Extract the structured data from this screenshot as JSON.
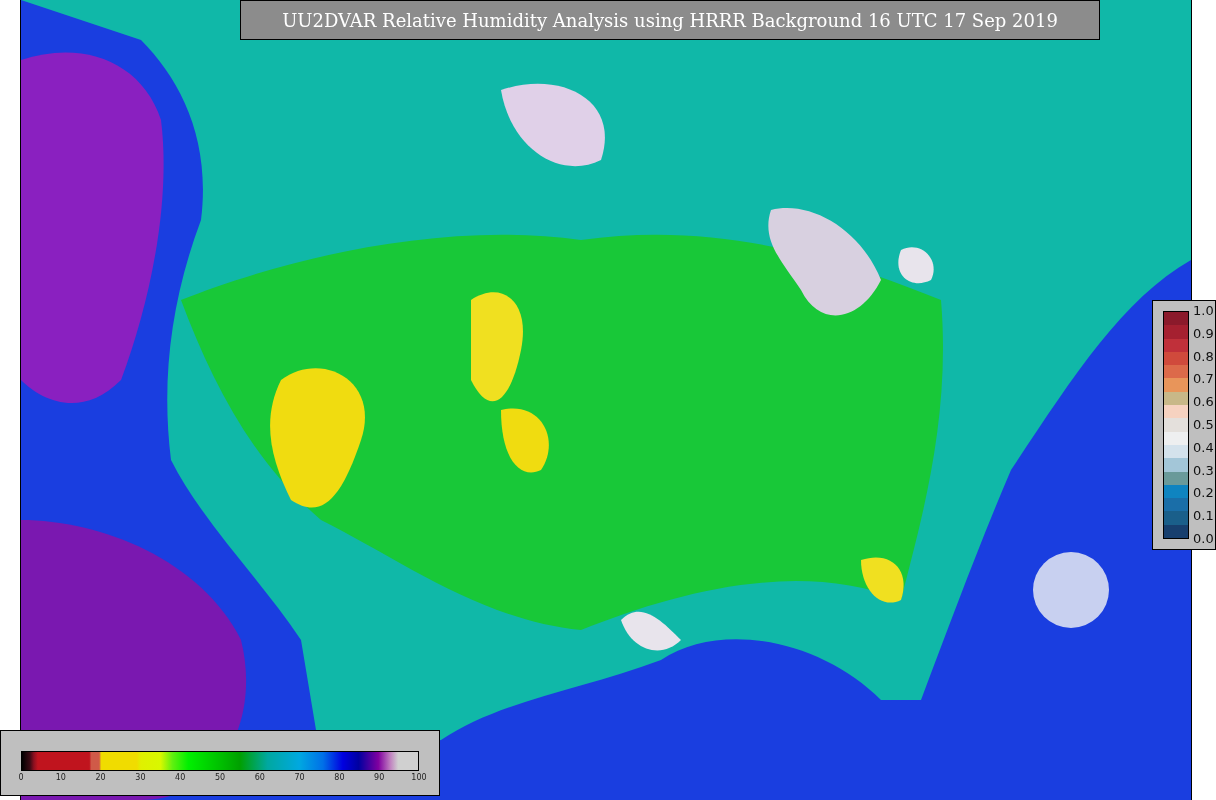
{
  "title": "UU2DVAR Relative Humidity Analysis using HRRR Background 16 UTC 17 Sep 2019",
  "humidity_colorbar": {
    "ticks": [
      "0",
      "10",
      "20",
      "30",
      "40",
      "50",
      "60",
      "70",
      "80",
      "90",
      "100"
    ]
  },
  "station_colorbar": {
    "ticks": [
      "1.0",
      "0.9",
      "0.8",
      "0.7",
      "0.6",
      "0.5",
      "0.4",
      "0.3",
      "0.2",
      "0.1",
      "0.0"
    ]
  }
}
